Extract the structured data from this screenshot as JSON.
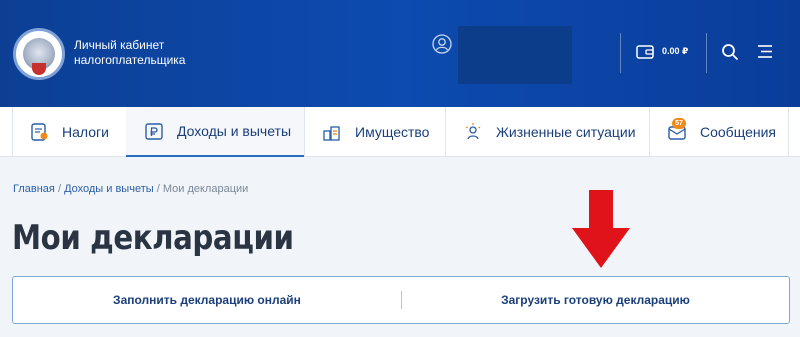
{
  "header": {
    "brand_line1": "Личный кабинет",
    "brand_line2": "налогоплательщика",
    "balance": "0.00 ₽",
    "bg_color": "#0d47a8"
  },
  "nav": {
    "items": [
      {
        "label": "Налоги",
        "icon": "tax-document-icon"
      },
      {
        "label": "Доходы и вычеты",
        "icon": "income-ruble-icon",
        "active": true
      },
      {
        "label": "Имущество",
        "icon": "property-icon"
      },
      {
        "label": "Жизненные ситуации",
        "icon": "life-situations-icon"
      },
      {
        "label": "Сообщения",
        "icon": "messages-icon",
        "badge": "57"
      }
    ]
  },
  "breadcrumb": {
    "items": [
      "Главная",
      "Доходы и вычеты",
      "Мои декларации"
    ]
  },
  "page": {
    "title": "Мои декларации"
  },
  "actions": {
    "fill_online": "Заполнить декларацию онлайн",
    "upload_ready": "Загрузить готовую декларацию"
  },
  "annotation": {
    "arrow_color": "#e0131b"
  }
}
